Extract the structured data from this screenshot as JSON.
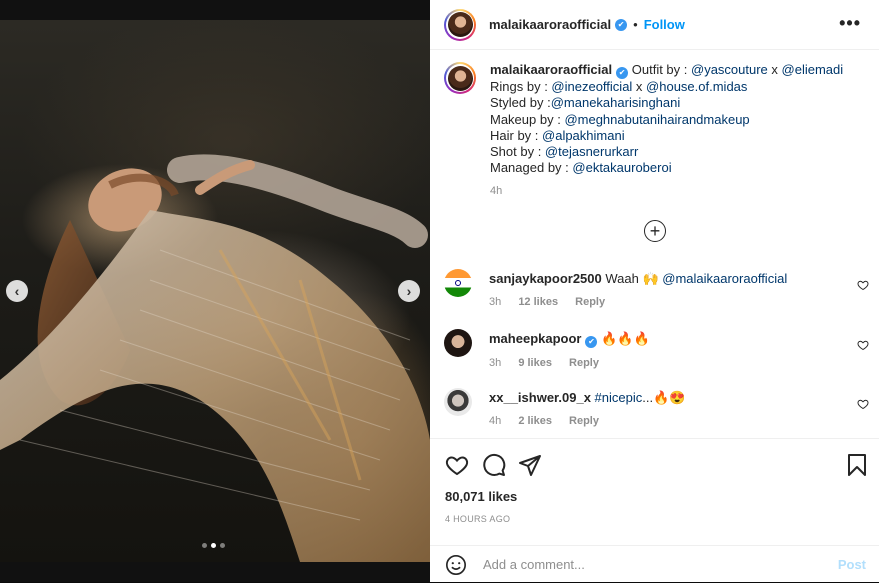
{
  "post": {
    "username": "malaikaaroraofficial",
    "follow_label": "Follow",
    "separator": "•",
    "more_icon": "more-horizontal-icon",
    "verified_mark": "✔"
  },
  "caption": {
    "username": "malaikaaroraofficial",
    "line1_prefix": "Outfit by : ",
    "line1_link1": "@yascouture",
    "line1_mid": " x ",
    "line1_link2": "@eliemadi",
    "line2_prefix": "Rings by : ",
    "line2_link1": "@inezeofficial",
    "line2_mid": " x ",
    "line2_link2": "@house.of.midas",
    "line3_prefix": "Styled by :",
    "line3_link": "@manekaharisinghani",
    "line4_prefix": "Makeup by : ",
    "line4_link": "@meghnabutanihairandmakeup",
    "line5_prefix": "Hair by : ",
    "line5_link": "@alpakhimani",
    "line6_prefix": "Shot by : ",
    "line6_link": "@tejasnerurkarr",
    "line7_prefix": "Managed by : ",
    "line7_link": "@ektakauroberoi",
    "time": "4h"
  },
  "load_more_symbol": "+",
  "comments": [
    {
      "username": "sanjaykapoor2500",
      "text_prefix": "Waah 🙌 ",
      "mention": "@malaikaaroraofficial",
      "time": "3h",
      "likes": "12 likes",
      "reply": "Reply"
    },
    {
      "username": "maheepkapoor",
      "text": "🔥🔥🔥",
      "time": "3h",
      "likes": "9 likes",
      "reply": "Reply"
    },
    {
      "username": "xx__ishwer.09_x",
      "hashtag": "#nicepic",
      "text_suffix": "...🔥😍",
      "time": "4h",
      "likes": "2 likes",
      "reply": "Reply"
    }
  ],
  "actions": {
    "likes": "80,071 likes",
    "posted": "4 HOURS AGO"
  },
  "add_comment": {
    "placeholder": "Add a comment...",
    "post_label": "Post"
  },
  "carousel": {
    "prev_symbol": "‹",
    "next_symbol": "›",
    "slide_count": 3,
    "active_slide": 2
  },
  "colors": {
    "link": "#00376b",
    "follow": "#0095f6",
    "verified": "#3897f0",
    "post_disabled": "#b2dffc"
  }
}
